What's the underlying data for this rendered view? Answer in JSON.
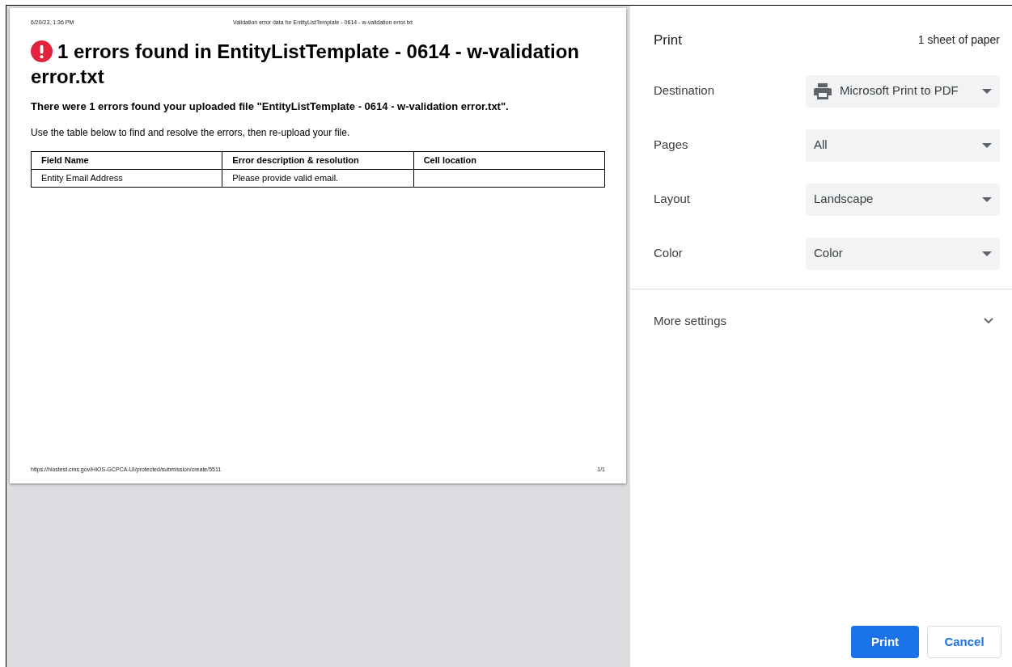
{
  "preview": {
    "header_date": "6/20/23, 1:36 PM",
    "header_title": "Validation error data for EntityListTemplate - 0614 - w-validation error.txt",
    "heading": "1 errors found in EntityListTemplate - 0614 - w-validation error.txt",
    "summary": "There were 1 errors found your uploaded file \"EntityListTemplate - 0614 - w-validation error.txt\".",
    "instruction": "Use the table below to find and resolve the errors, then re-upload your file.",
    "table": {
      "columns": [
        "Field Name",
        "Error description & resolution",
        "Cell location"
      ],
      "rows": [
        [
          "Entity Email Address",
          "Please provide valid email.",
          ""
        ]
      ]
    },
    "footer_url": "https://hiostest.cms.gov/HIOS-GCPCA-UI/protected/submission/create/5511",
    "footer_page": "1/1"
  },
  "panel": {
    "title": "Print",
    "sheets": "1 sheet of paper",
    "settings": [
      {
        "label": "Destination",
        "value": "Microsoft Print to PDF",
        "kind": "device-select"
      },
      {
        "label": "Pages",
        "value": "All",
        "kind": "select"
      },
      {
        "label": "Layout",
        "value": "Landscape",
        "kind": "select"
      },
      {
        "label": "Color",
        "value": "Color",
        "kind": "select"
      }
    ],
    "more_settings": {
      "label": "More settings",
      "expanded": false
    },
    "buttons": [
      {
        "label": "Print",
        "kind": "primary"
      },
      {
        "label": "Cancel",
        "kind": "secondary"
      }
    ]
  }
}
